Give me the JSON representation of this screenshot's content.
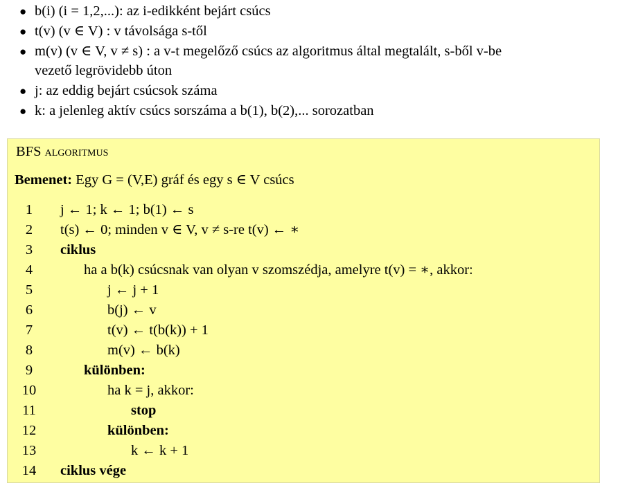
{
  "bullets": [
    {
      "text": "b(i) (i = 1,2,...): az i-edikként bejárt csúcs"
    },
    {
      "text": "t(v) (v ∈ V) : v távolsága s-től"
    },
    {
      "text": "m(v) (v ∈ V, v ≠ s) : a v-t megelőző csúcs az algoritmus által megtalált, s-ből v-be"
    },
    {
      "text": "vezető legrövidebb úton"
    },
    {
      "text": "j: az eddig bejárt csúcsok száma"
    },
    {
      "text": "k: a jelenleg aktív csúcs sorszáma a b(1), b(2),... sorozatban"
    }
  ],
  "algorithm": {
    "title": "BFS algoritmus",
    "input_label": "Bemenet:",
    "input_text": "Egy G = (V,E) gráf és egy s ∈ V csúcs",
    "lines": [
      {
        "num": "1",
        "text": "j ← 1; k ← 1; b(1) ← s"
      },
      {
        "num": "2",
        "text": "t(s) ← 0; minden v ∈ V, v ≠ s-re t(v) ← ∗"
      },
      {
        "num": "3",
        "text": "ciklus"
      },
      {
        "num": "4",
        "text": "ha a b(k) csúcsnak van olyan v szomszédja, amelyre t(v) = ∗, akkor:"
      },
      {
        "num": "5",
        "text": "j ← j + 1"
      },
      {
        "num": "6",
        "text": "b(j) ← v"
      },
      {
        "num": "7",
        "text": "t(v) ← t(b(k)) + 1"
      },
      {
        "num": "8",
        "text": "m(v) ← b(k)"
      },
      {
        "num": "9",
        "text": "különben:"
      },
      {
        "num": "10",
        "text": "ha k = j, akkor:"
      },
      {
        "num": "11",
        "text": "stop"
      },
      {
        "num": "12",
        "text": "különben:"
      },
      {
        "num": "13",
        "text": "k ← k + 1"
      },
      {
        "num": "14",
        "text": "ciklus vége"
      }
    ]
  }
}
